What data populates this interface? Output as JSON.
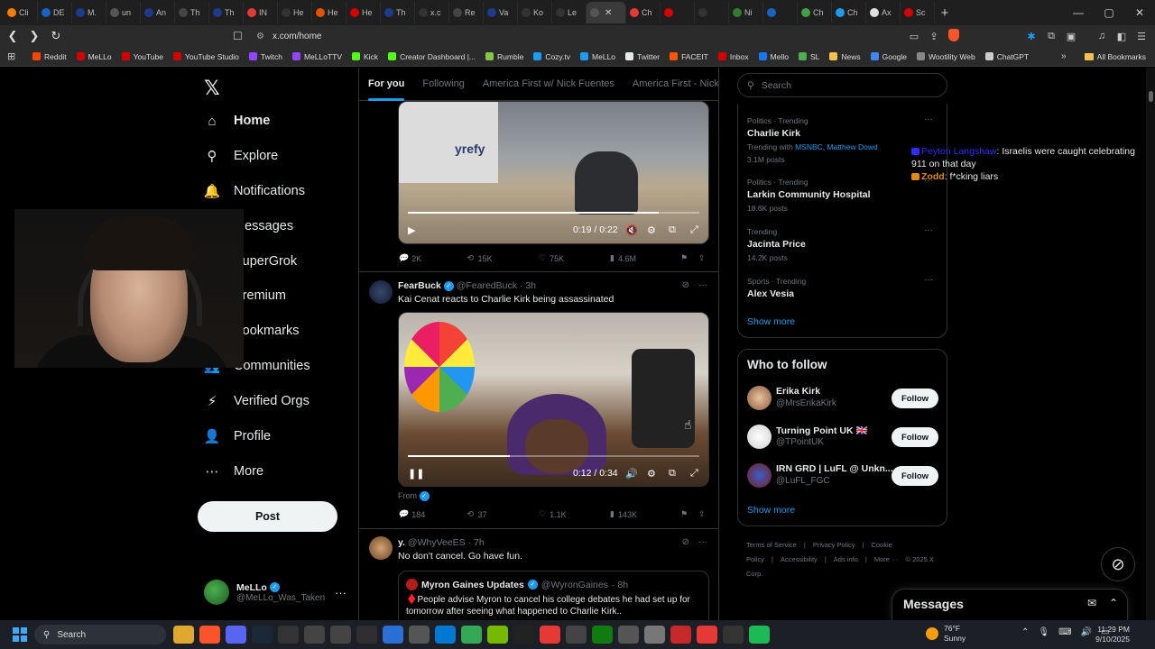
{
  "browser": {
    "tabs": [
      {
        "label": "Cli",
        "color": "#f57c00"
      },
      {
        "label": "DE",
        "color": "#1565c0"
      },
      {
        "label": "M.",
        "color": "#1e3a8a"
      },
      {
        "label": "un",
        "color": "#555555"
      },
      {
        "label": "An",
        "color": "#1e3a8a"
      },
      {
        "label": "Th",
        "color": "#444444"
      },
      {
        "label": "Th",
        "color": "#1e3a8a"
      },
      {
        "label": "IN",
        "color": "#e53935"
      },
      {
        "label": "He",
        "color": "#333333"
      },
      {
        "label": "He",
        "color": "#e65100"
      },
      {
        "label": "He",
        "color": "#d50000"
      },
      {
        "label": "Th",
        "color": "#1e3a8a"
      },
      {
        "label": "x.c",
        "color": "#333333"
      },
      {
        "label": "Re",
        "color": "#444444"
      },
      {
        "label": "Va",
        "color": "#1e3a8a"
      },
      {
        "label": "Ko",
        "color": "#333333"
      },
      {
        "label": "Le",
        "color": "#333333"
      },
      {
        "label": "",
        "color": "#555555",
        "active": true
      },
      {
        "label": "Ch",
        "color": "#e53935"
      },
      {
        "label": "",
        "color": "#d50000"
      },
      {
        "label": "",
        "color": "#333333"
      },
      {
        "label": "Ni",
        "color": "#2e7d32"
      },
      {
        "label": "",
        "color": "#1565c0"
      },
      {
        "label": "Ch",
        "color": "#43a047"
      },
      {
        "label": "Ch",
        "color": "#1d9bf0"
      },
      {
        "label": "Ax",
        "color": "#e0e0e0"
      },
      {
        "label": "Sc",
        "color": "#d50000"
      }
    ],
    "new_tab": "+",
    "window_controls": [
      "—",
      "▢",
      "✕"
    ],
    "url": "x.com/home",
    "bookmarks": [
      {
        "label": "Reddit",
        "color": "#ff4500"
      },
      {
        "label": "MeLLo",
        "color": "#d50000"
      },
      {
        "label": "YouTube",
        "color": "#d50000"
      },
      {
        "label": "YouTube Studio",
        "color": "#d50000"
      },
      {
        "label": "Twitch",
        "color": "#9146ff"
      },
      {
        "label": "MeLLoTTV",
        "color": "#9146ff"
      },
      {
        "label": "Kick",
        "color": "#53fc18"
      },
      {
        "label": "Creator Dashboard |...",
        "color": "#53fc18"
      },
      {
        "label": "Rumble",
        "color": "#85c742"
      },
      {
        "label": "Cozy.tv",
        "color": "#1d9bf0"
      },
      {
        "label": "MeLLo",
        "color": "#1d9bf0"
      },
      {
        "label": "Twitter",
        "color": "#e7e9ea"
      },
      {
        "label": "FACEIT",
        "color": "#ff5500"
      },
      {
        "label": "Inbox",
        "color": "#d50000"
      },
      {
        "label": "Mello",
        "color": "#1877f2"
      },
      {
        "label": "SL",
        "color": "#4caf50"
      },
      {
        "label": "News",
        "color": "#f2c14e"
      },
      {
        "label": "Google",
        "color": "#4285f4"
      },
      {
        "label": "Wootility Web",
        "color": "#888888"
      },
      {
        "label": "ChatGPT",
        "color": "#cccccc"
      }
    ],
    "bookmarks_more": "»",
    "all_bookmarks": "All Bookmarks"
  },
  "nav": {
    "items": [
      {
        "label": "Home",
        "icon": "home-icon",
        "glyph": "⌂"
      },
      {
        "label": "Explore",
        "icon": "search-icon",
        "glyph": "⚲"
      },
      {
        "label": "Notifications",
        "icon": "bell-icon",
        "glyph": "🔔"
      },
      {
        "label": "Messages",
        "icon": "mail-icon",
        "glyph": "✉"
      },
      {
        "label": "SuperGrok",
        "icon": "grok-icon",
        "glyph": "⊘"
      },
      {
        "label": "Premium",
        "icon": "x-icon",
        "glyph": "✕"
      },
      {
        "label": "Bookmarks",
        "icon": "bookmark-icon",
        "glyph": "⚑"
      },
      {
        "label": "Communities",
        "icon": "people-icon",
        "glyph": "👥"
      },
      {
        "label": "Verified Orgs",
        "icon": "bolt-icon",
        "glyph": "⚡"
      },
      {
        "label": "Profile",
        "icon": "person-icon",
        "glyph": "👤"
      },
      {
        "label": "More",
        "icon": "more-circle-icon",
        "glyph": "⋯"
      }
    ],
    "post_label": "Post",
    "account": {
      "name": "MeLLo",
      "handle": "@MeLLo_Was_Taken",
      "more": "···"
    }
  },
  "feed": {
    "tabs": [
      "For you",
      "Following",
      "America First w/ Nick Fuentes",
      "America First - Nick Fu"
    ],
    "tweet1": {
      "video_time": "0:19 / 0:22",
      "progress": 0.86,
      "video_text": "yrefy",
      "replies": "2K",
      "reposts": "15K",
      "likes": "75K",
      "views": "4.6M"
    },
    "tweet2": {
      "name": "FearBuck",
      "handle": "@FearedBuck",
      "time": "· 3h",
      "text": "Kai Cenat reacts to Charlie Kirk being assassinated",
      "video_time": "0:12 / 0:34",
      "progress": 0.35,
      "from": "From",
      "replies": "184",
      "reposts": "37",
      "likes": "1.1K",
      "views": "143K"
    },
    "tweet3": {
      "name": "y.",
      "handle": "@WhyVeeES",
      "time": "· 7h",
      "text": "No don't cancel. Go have fun.",
      "quote": {
        "name": "Myron Gaines Updates",
        "handle": "@WyronGaines",
        "time": "· 8h",
        "text": "♦️People advise Myron to cancel his college debates he had set up for tomorrow after seeing what happened to Charlie Kirk.."
      }
    }
  },
  "sidebar": {
    "search_placeholder": "Search",
    "trends": [
      {
        "meta": "Politics · Trending",
        "title": "Charlie Kirk",
        "sub_prefix": "Trending with",
        "sub_link": "MSNBC, Matthew Dowd",
        "count": "3.1M posts"
      },
      {
        "meta": "Politics · Trending",
        "title": "Larkin Community Hospital",
        "count": "18.6K posts"
      },
      {
        "meta": "Trending",
        "title": "Jacinta Price",
        "count": "14.2K posts"
      },
      {
        "meta": "Sports · Trending",
        "title": "Alex Vesia",
        "count": ""
      }
    ],
    "show_more": "Show more",
    "who_to_follow": "Who to follow",
    "follow": [
      {
        "name": "Erika Kirk",
        "handle": "@MrsErikaKirk",
        "button": "Follow"
      },
      {
        "name": "Turning Point UK 🇬🇧",
        "handle": "@TPointUK",
        "button": "Follow"
      },
      {
        "name": "IRN GRD | LuFL @ Unkn...",
        "handle": "@LuFL_FGC",
        "button": "Follow"
      }
    ],
    "footer": [
      "Terms of Service",
      "|",
      "Privacy Policy",
      "|",
      "Cookie Policy",
      "|",
      "Accessibility",
      "|",
      "Ads info",
      "|",
      "More ···",
      "© 2025 X Corp."
    ]
  },
  "stream_chat": [
    {
      "name": "Peyton Langshaw",
      "sep": ":",
      "text": " Israelis were caught celebrating 911 on that day"
    },
    {
      "name": "Zodd",
      "sep": ":",
      "text": " f*cking liars"
    }
  ],
  "messages_drawer": {
    "title": "Messages"
  },
  "taskbar": {
    "search": "Search",
    "weather_temp": "76°F",
    "weather_desc": "Sunny",
    "weather_badge": "2",
    "time": "11:29 PM",
    "date": "9/10/2025"
  }
}
